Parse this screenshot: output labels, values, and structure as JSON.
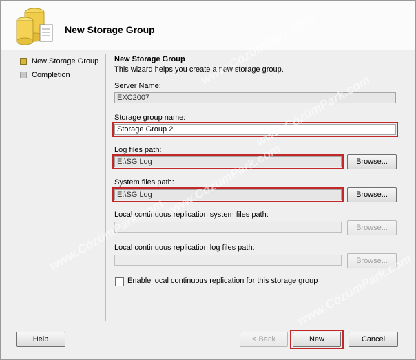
{
  "wizard": {
    "title": "New Storage Group",
    "nav": [
      {
        "label": "New Storage Group",
        "active": true
      },
      {
        "label": "Completion",
        "active": false
      }
    ]
  },
  "content": {
    "heading": "New Storage Group",
    "description": "This wizard helps you create a new storage group.",
    "server_name": {
      "label": "Server Name:",
      "value": "EXC2007"
    },
    "storage_group_name": {
      "label": "Storage group name:",
      "value": "Storage Group 2"
    },
    "log_files_path": {
      "label": "Log files path:",
      "value": "E:\\SG Log",
      "browse": "Browse..."
    },
    "system_files_path": {
      "label": "System files path:",
      "value": "E:\\SG Log",
      "browse": "Browse..."
    },
    "lcr_system_files_path": {
      "label": "Local continuous replication system files path:",
      "value": "",
      "browse": "Browse..."
    },
    "lcr_log_files_path": {
      "label": "Local continuous replication log files path:",
      "value": "",
      "browse": "Browse..."
    },
    "enable_lcr": {
      "label": "Enable local continuous replication for this storage group",
      "checked": false
    }
  },
  "footer": {
    "help": "Help",
    "back": "< Back",
    "new": "New",
    "cancel": "Cancel"
  },
  "watermark": "www.CözümPark.com",
  "colors": {
    "highlight": "#c0282a",
    "active_nav": "#d4b83d"
  }
}
